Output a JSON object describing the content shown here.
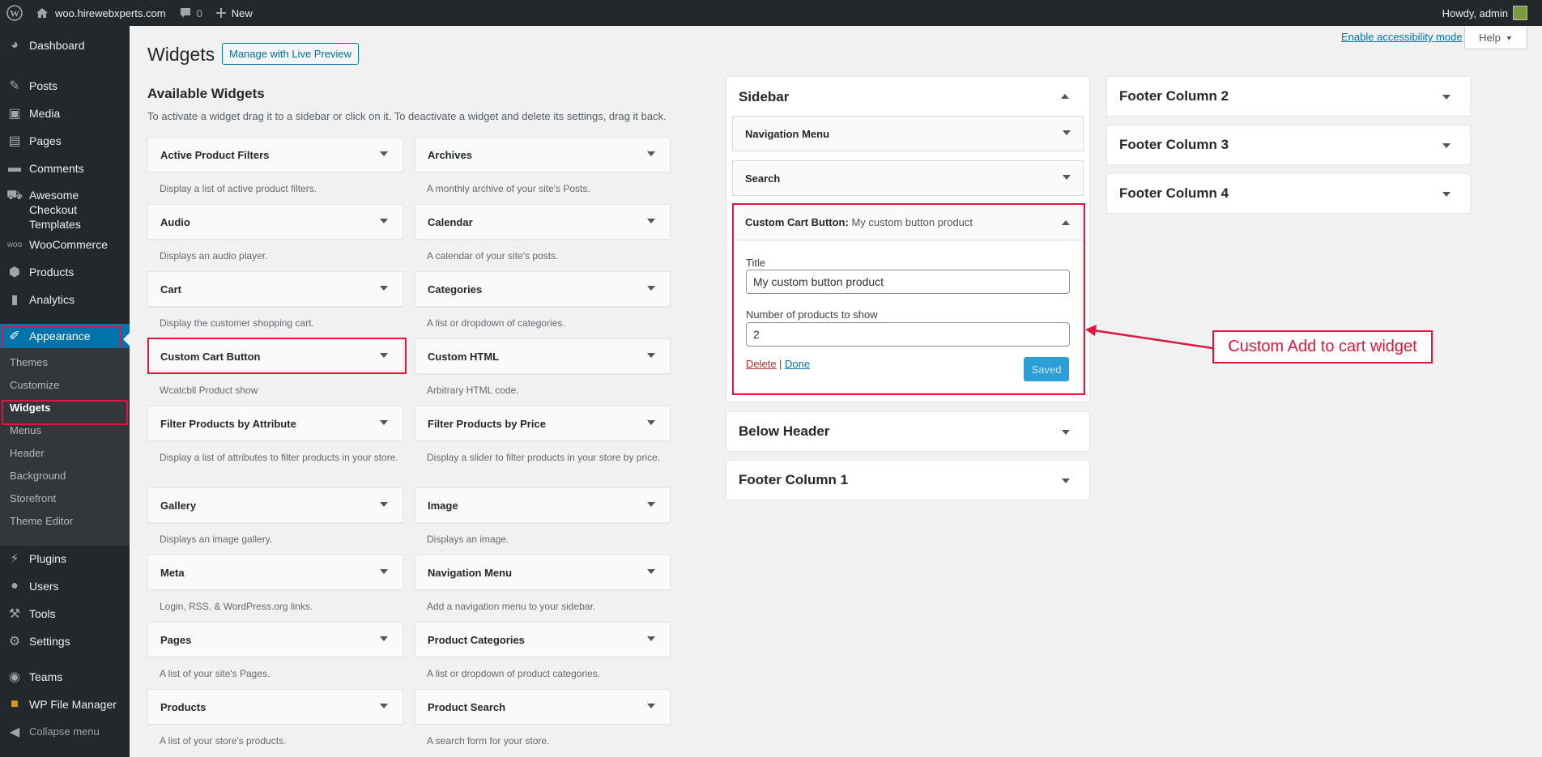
{
  "adminbar": {
    "site_name": "woo.hirewebxperts.com",
    "comments_count": "0",
    "new_label": "New",
    "howdy": "Howdy, admin"
  },
  "menu": {
    "dashboard": "Dashboard",
    "posts": "Posts",
    "media": "Media",
    "pages": "Pages",
    "comments": "Comments",
    "awesome_line1": "Awesome Checkout",
    "awesome_line2": "Templates",
    "woocommerce": "WooCommerce",
    "products": "Products",
    "analytics": "Analytics",
    "appearance": "Appearance",
    "plugins": "Plugins",
    "users": "Users",
    "tools": "Tools",
    "settings": "Settings",
    "teams": "Teams",
    "wp_file_manager": "WP File Manager",
    "collapse": "Collapse menu",
    "submenu": {
      "themes": "Themes",
      "customize": "Customize",
      "widgets": "Widgets",
      "menus": "Menus",
      "header": "Header",
      "background": "Background",
      "storefront": "Storefront",
      "theme_editor": "Theme Editor"
    }
  },
  "page": {
    "title": "Widgets",
    "live_preview": "Manage with Live Preview",
    "accessibility": "Enable accessibility mode",
    "help": "Help"
  },
  "available": {
    "heading": "Available Widgets",
    "description": "To activate a widget drag it to a sidebar or click on it. To deactivate a widget and delete its settings, drag it back.",
    "widgets": [
      {
        "name": "Active Product Filters",
        "desc": "Display a list of active product filters."
      },
      {
        "name": "Archives",
        "desc": "A monthly archive of your site's Posts."
      },
      {
        "name": "Audio",
        "desc": "Displays an audio player."
      },
      {
        "name": "Calendar",
        "desc": "A calendar of your site's posts."
      },
      {
        "name": "Cart",
        "desc": "Display the customer shopping cart."
      },
      {
        "name": "Categories",
        "desc": "A list or dropdown of categories."
      },
      {
        "name": "Custom Cart Button",
        "desc": "Wcatcbll Product show"
      },
      {
        "name": "Custom HTML",
        "desc": "Arbitrary HTML code."
      },
      {
        "name": "Filter Products by Attribute",
        "desc": "Display a list of attributes to filter products in your store."
      },
      {
        "name": "Filter Products by Price",
        "desc": "Display a slider to filter products in your store by price."
      },
      {
        "name": "Gallery",
        "desc": "Displays an image gallery."
      },
      {
        "name": "Image",
        "desc": "Displays an image."
      },
      {
        "name": "Meta",
        "desc": "Login, RSS, & WordPress.org links."
      },
      {
        "name": "Navigation Menu",
        "desc": "Add a navigation menu to your sidebar."
      },
      {
        "name": "Pages",
        "desc": "A list of your site's Pages."
      },
      {
        "name": "Product Categories",
        "desc": "A list or dropdown of product categories."
      },
      {
        "name": "Products",
        "desc": "A list of your store's products."
      },
      {
        "name": "Product Search",
        "desc": "A search form for your store."
      }
    ]
  },
  "sidebar": {
    "title": "Sidebar",
    "widgets": {
      "nav": "Navigation Menu",
      "search": "Search",
      "custom_title": "Custom Cart Button:",
      "custom_subtitle": "My custom button product"
    },
    "form": {
      "title_label": "Title",
      "title_value": "My custom button product",
      "count_label": "Number of products to show",
      "count_value": "2",
      "delete": "Delete",
      "separator": "|",
      "done": "Done",
      "saved": "Saved"
    }
  },
  "areas": {
    "below_header": "Below Header",
    "footer1": "Footer Column 1",
    "footer2": "Footer Column 2",
    "footer3": "Footer Column 3",
    "footer4": "Footer Column 4"
  },
  "annotation": "Custom Add to cart widget",
  "colors": {
    "highlight": "#e0173c",
    "primary": "#0073aa",
    "menu_bg": "#23282d"
  }
}
